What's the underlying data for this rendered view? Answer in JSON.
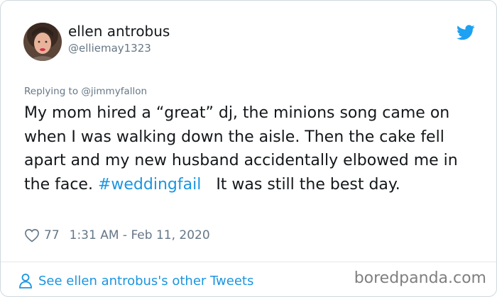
{
  "author": {
    "name": "ellen antrobus",
    "handle": "@elliemay1323",
    "avatar_icon": "avatar-photo"
  },
  "tweet": {
    "reply_prefix": "Replying to ",
    "reply_to": "@jimmyfallon",
    "text_before_hashtag": "My mom hired a “great” dj, the minions song came on when I was walking down the aisle. Then the cake fell apart and my new husband accidentally elbowed me in the face. ",
    "hashtag": "#weddingfail",
    "text_after_hashtag": "It was still the best day."
  },
  "meta": {
    "likes": "77",
    "timestamp": "1:31 AM - Feb 11, 2020",
    "heart_icon": "heart-icon"
  },
  "footer": {
    "see_more": "See ellen antrobus's other Tweets",
    "person_icon": "person-icon"
  },
  "watermark": "boredpanda.com",
  "colors": {
    "accent": "#1b95e0",
    "secondary_text": "#657786",
    "primary_text": "#14171a",
    "border": "#cfd9de"
  }
}
